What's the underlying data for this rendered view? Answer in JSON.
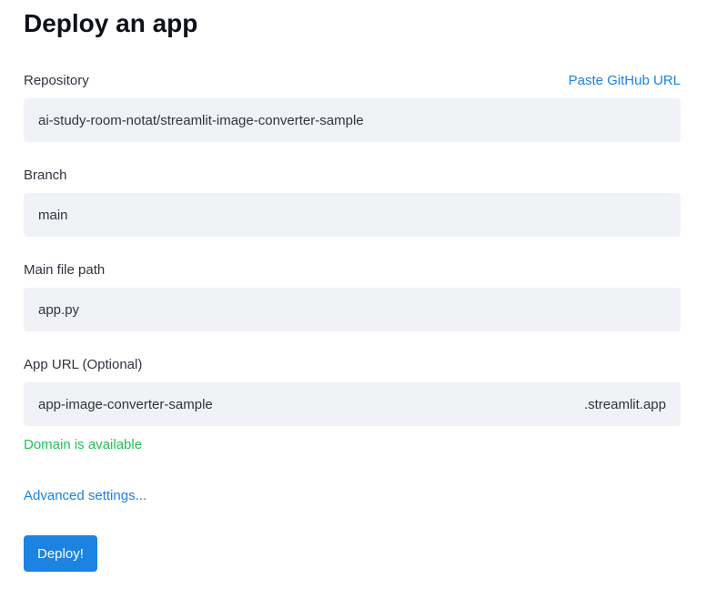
{
  "title": "Deploy an app",
  "repository": {
    "label": "Repository",
    "value": "ai-study-room-notat/streamlit-image-converter-sample",
    "paste_link": "Paste GitHub URL"
  },
  "branch": {
    "label": "Branch",
    "value": "main"
  },
  "main_file": {
    "label": "Main file path",
    "value": "app.py"
  },
  "app_url": {
    "label": "App URL (Optional)",
    "value": "app-image-converter-sample",
    "suffix": ".streamlit.app",
    "status": "Domain is available"
  },
  "advanced_link": "Advanced settings...",
  "deploy_label": "Deploy!"
}
